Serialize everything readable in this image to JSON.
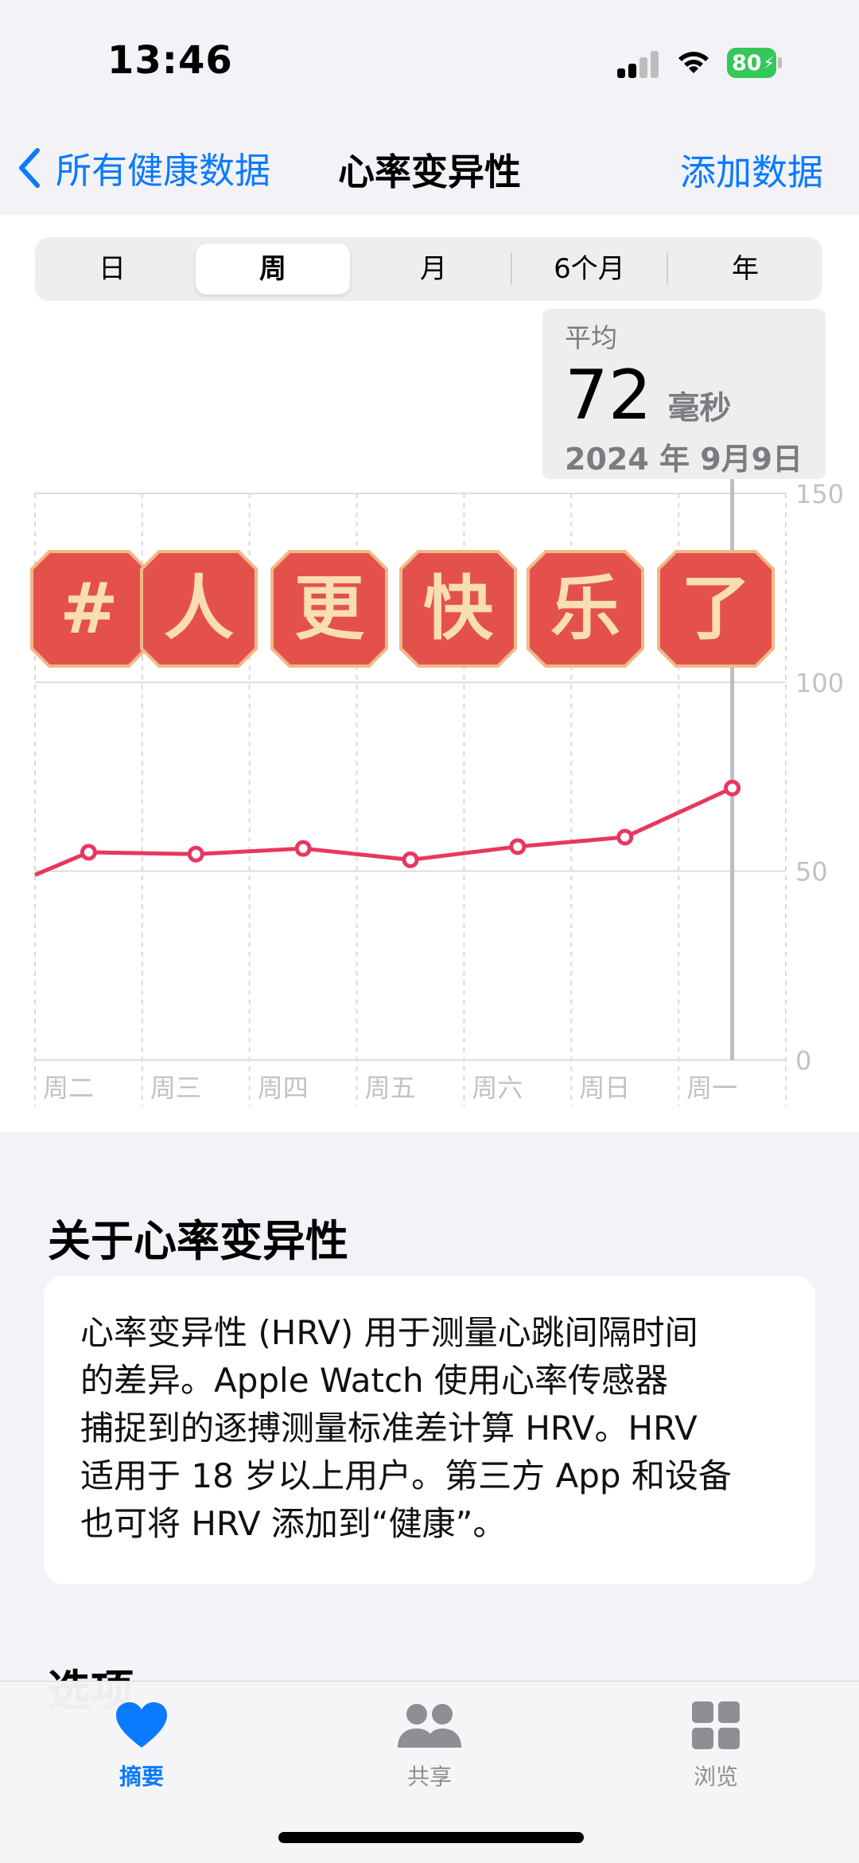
{
  "status_bar": {
    "time": "13:46",
    "battery": "80"
  },
  "nav": {
    "back_label": "所有健康数据",
    "title": "心率变异性",
    "action_label": "添加数据"
  },
  "segments": [
    "日",
    "周",
    "月",
    "6个月",
    "年"
  ],
  "selected_segment": "周",
  "summary": {
    "label": "平均",
    "value": "72",
    "unit": "毫秒",
    "date": "2024 年 9月9日"
  },
  "overlay_badges": [
    "#",
    "人",
    "更",
    "快",
    "乐",
    "了"
  ],
  "chart_data": {
    "type": "line",
    "categories": [
      "周二",
      "周三",
      "周四",
      "周五",
      "周六",
      "周日",
      "周一"
    ],
    "series": [
      {
        "values": [
          55,
          54.5,
          56,
          53,
          56.5,
          59,
          72
        ]
      }
    ],
    "lead_in_value": 49,
    "yticks": [
      0,
      50,
      100,
      150
    ],
    "ylim": [
      0,
      150
    ],
    "line_color": "#E8375E",
    "highlighted_category": "周一"
  },
  "about": {
    "title": "关于心率变异性",
    "lines": [
      "心率变异性 (HRV) 用于测量心跳间隔时间",
      "的差异。Apple Watch 使用心率传感器",
      "捕捉到的逐搏测量标准差计算 HRV。HRV",
      "适用于 18 岁以上用户。第三方 App 和设备",
      "也可将 HRV 添加到“健康”。"
    ]
  },
  "options_title": "选项",
  "tabs": [
    {
      "label": "摘要",
      "icon": "heart-icon"
    },
    {
      "label": "共享",
      "icon": "people-icon"
    },
    {
      "label": "浏览",
      "icon": "grid-icon"
    }
  ],
  "colors": {
    "accent": "#0A7AFF",
    "badge": "#E4514B",
    "badge_text": "#F9DDB3"
  }
}
